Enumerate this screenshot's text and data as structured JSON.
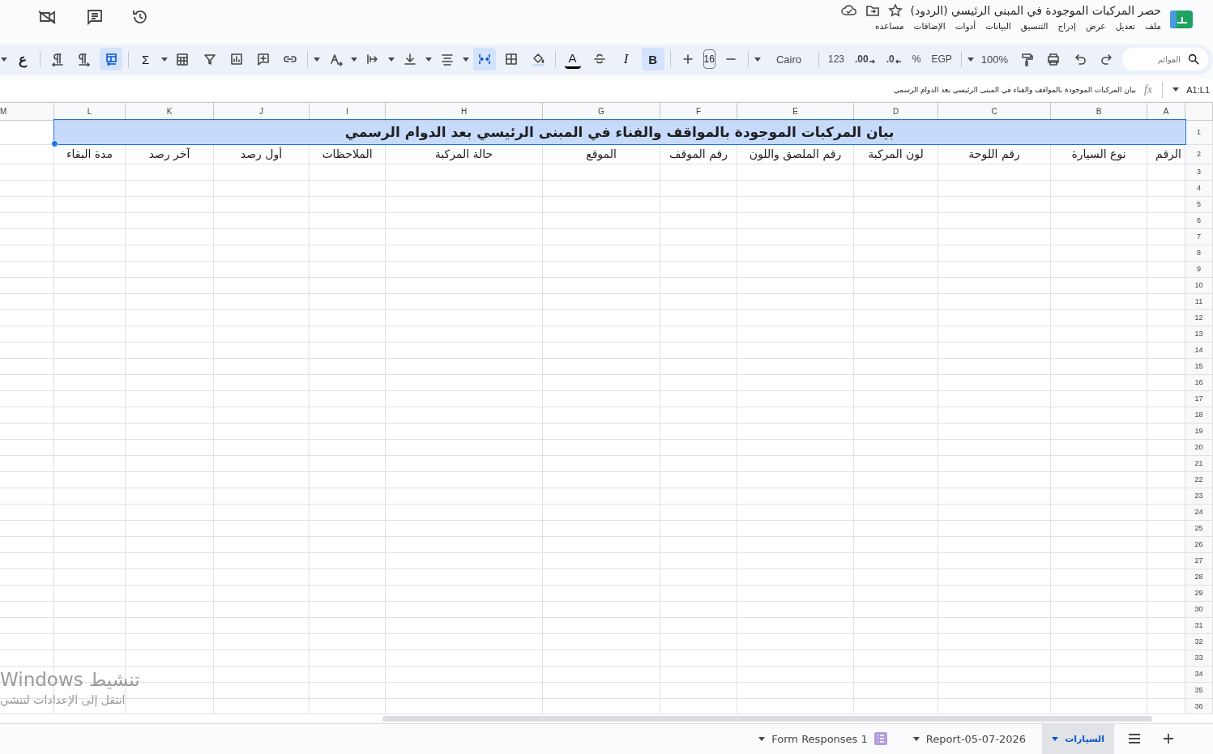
{
  "title_bar": {
    "title": "حصر المركبات الموجودة في المبنى الرئيسي (الردود)"
  },
  "menu": [
    "ملف",
    "تعديل",
    "عرض",
    "إدراج",
    "التنسيق",
    "البيانات",
    "أدوات",
    "الإضافات",
    "مساعده"
  ],
  "toolbar": {
    "search_placeholder": "القوائم",
    "zoom": "100%",
    "currency": "EGP",
    "percent": "%",
    "decrease_decimals": ".0",
    "increase_decimals": ".00",
    "number_format": "123",
    "font": "Cairo",
    "font_size": "16",
    "bold": {
      "label": "B",
      "on": true
    },
    "italic": {
      "label": "I",
      "on": false
    },
    "text_color": "A",
    "merge_cells": {
      "on": true
    },
    "sheet_rtl": {
      "on": true
    },
    "sum": "Σ",
    "input_tools": "ع"
  },
  "formula_bar": {
    "name_box": "A1:L1",
    "fx": "fx",
    "formula": "بيان المركبات الموجودة بالمواقف والفناء في المبنى الرئيسي بعد الدوام الرسمي"
  },
  "sheet": {
    "columns": [
      "A",
      "B",
      "C",
      "D",
      "E",
      "F",
      "G",
      "H",
      "I",
      "J",
      "K",
      "L",
      "M"
    ],
    "title": "بيان المركبات الموجودة بالمواقف والفناء في المبنى الرئيسي بعد الدوام الرسمي",
    "headers": [
      "الرقم",
      "نوع السيارة",
      "رقم اللوحة",
      "لون المركبة",
      "رقم الملصق واللون",
      "رقم الموقف",
      "الموقع",
      "حالة المركبة",
      "الملاحظات",
      "أول رصد",
      "آخر رصد",
      "مدة البقاء"
    ],
    "row_numbers": [
      "1",
      "2",
      "3",
      "4",
      "5",
      "6",
      "7",
      "8",
      "9",
      "10",
      "11",
      "12",
      "13",
      "14",
      "15",
      "16",
      "17",
      "18",
      "19",
      "20",
      "21",
      "22",
      "23",
      "24",
      "25",
      "26",
      "27",
      "28",
      "29",
      "30",
      "31",
      "32",
      "33",
      "34",
      "35",
      "36"
    ]
  },
  "tabs": [
    {
      "label": "السيارات",
      "selected": true,
      "form_linked": false
    },
    {
      "label": "Report-05-07-2026",
      "selected": false,
      "form_linked": false
    },
    {
      "label": "Form Responses 1",
      "selected": false,
      "form_linked": true
    }
  ],
  "os_overlay": {
    "line_1": "تنشيط Windows",
    "line_2": "انتقل إلى الإعدادات لتنشي"
  }
}
